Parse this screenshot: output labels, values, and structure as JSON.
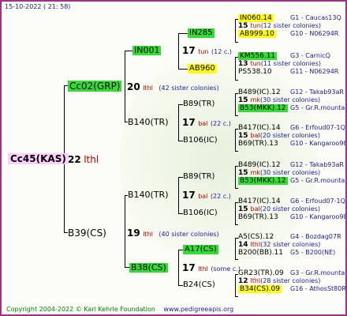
{
  "header": {
    "date": "15-10-2022 ( 21: 58)"
  },
  "root": {
    "name": "Cc45(KAS)",
    "gen": "22",
    "breeder": "lthl"
  },
  "p1": {
    "name": "Cc02(GRP)",
    "gen": "20",
    "breeder": "lthl",
    "note": "(42 sister colonies)"
  },
  "p2": {
    "name": "B39(CS)",
    "gen": "19",
    "breeder": "lthl",
    "note": "(40 sister colonies)"
  },
  "g3": [
    {
      "name": "IN001",
      "gen": "17",
      "breeder": "tun",
      "note": "(12 c.)"
    },
    {
      "name": "B140(TR)",
      "gen": "17",
      "breeder": "bal",
      "note": "(22 c.)"
    },
    {
      "name": "B140(TR)",
      "gen": "17",
      "breeder": "bal",
      "note": "(22 c.)"
    },
    {
      "name": "B38(CS)",
      "gen": "17",
      "breeder": "lthl",
      "note": "(some c.)"
    }
  ],
  "g4": [
    {
      "name": "IN285"
    },
    {
      "name": "AB960"
    },
    {
      "name": "B89(TR)"
    },
    {
      "name": "B106(IC)"
    },
    {
      "name": "B89(TR)"
    },
    {
      "name": "B106(IC)"
    },
    {
      "name": "A17(CS)"
    },
    {
      "name": "B24(CS)"
    }
  ],
  "g5": [
    {
      "a": "IN060.14",
      "a_info": "G1 - Caucas13Q",
      "mid_gen": "15",
      "mid_breeder": "tun",
      "mid_note": "(12 sister colonies)",
      "b": "AB999.10",
      "b_info": "G10 - N06294R"
    },
    {
      "a": "KM556.11",
      "a_info": "G3 - CarnicQ",
      "mid_gen": "13",
      "mid_breeder": "tun",
      "mid_note": "(11 sister colonies)",
      "b": "PS538.10",
      "b_info": "G11 - N06294R"
    },
    {
      "a": "B489(IC).12",
      "a_info": "G12 - Takab93aR",
      "mid_gen": "15",
      "mid_breeder": "mk",
      "mid_note": "(30 sister colonies)",
      "b": "B53(MKK).12",
      "b_info": "G5 - Gr.R.mounta"
    },
    {
      "a": "B417(IC).14",
      "a_info": "G6 - Erfoud07-1Q",
      "mid_gen": "15",
      "mid_breeder": "bal",
      "mid_note": "(20 sister colonies)",
      "b": "B69(TR).13",
      "b_info": "G10 - Kangaroo98R"
    },
    {
      "a": "B489(IC).12",
      "a_info": "G12 - Takab93aR",
      "mid_gen": "15",
      "mid_breeder": "mk",
      "mid_note": "(30 sister colonies)",
      "b": "B53(MKK).12",
      "b_info": "G5 - Gr.R.mounta"
    },
    {
      "a": "B417(IC).14",
      "a_info": "G6 - Erfoud07-1Q",
      "mid_gen": "15",
      "mid_breeder": "bal",
      "mid_note": "(20 sister colonies)",
      "b": "B69(TR).13",
      "b_info": "G10 - Kangaroo98R"
    },
    {
      "a": "A5(CS).12",
      "a_info": "G4 - Bozdag07R",
      "mid_gen": "14",
      "mid_breeder": "lthl",
      "mid_note": "(32 sister colonies)",
      "b": "B200(BB).11",
      "b_info": "G5 - B200(NE)"
    },
    {
      "a": "GR23(TR).09",
      "a_info": "G3 - Gr.R.mounta",
      "mid_gen": "12",
      "mid_breeder": "lthl",
      "mid_note": "(28 sister colonies)",
      "b": "B34(CS).09",
      "b_info": "G16 - AthosSt80R"
    }
  ],
  "footer": {
    "copyright": "Copyright 2004-2022 © Karl Kehrle Foundation",
    "url": "www.pedigreeapis.org"
  },
  "colors": {
    "border": "#a0308a",
    "green_hl": "#33dd33",
    "yellow_hl": "#ffff00",
    "pink_hl": "#ffd0ff",
    "blue_text": "#1a1aa0",
    "red_text": "#c00000"
  }
}
